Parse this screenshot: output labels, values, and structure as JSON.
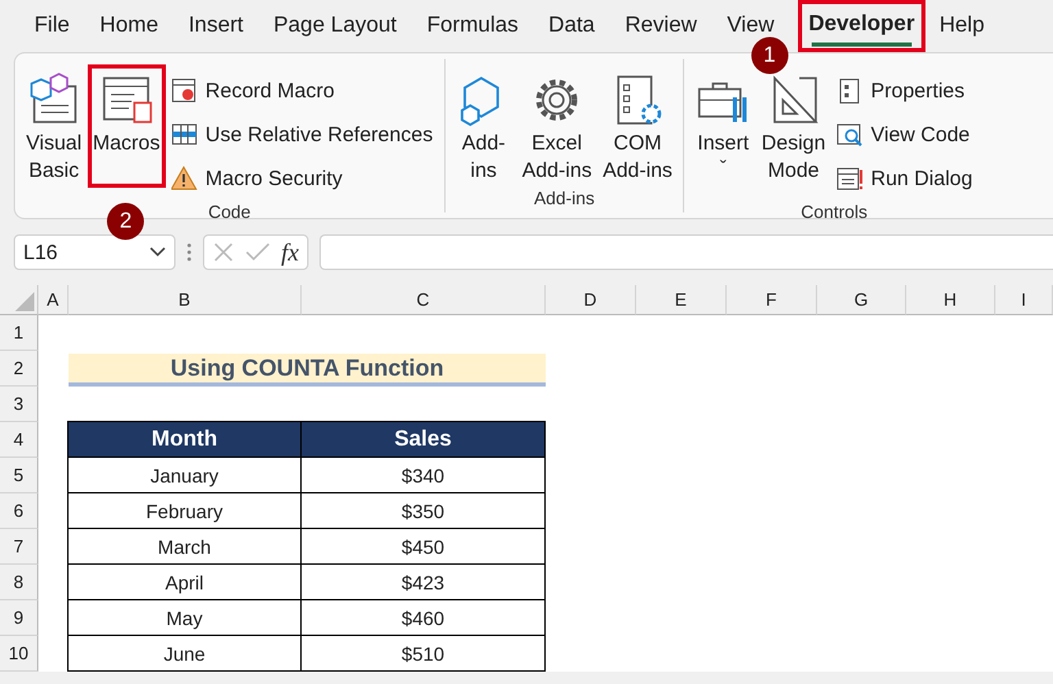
{
  "menu": [
    {
      "label": "File",
      "selected": false
    },
    {
      "label": "Home",
      "selected": false
    },
    {
      "label": "Insert",
      "selected": false
    },
    {
      "label": "Page Layout",
      "selected": false
    },
    {
      "label": "Formulas",
      "selected": false
    },
    {
      "label": "Data",
      "selected": false
    },
    {
      "label": "Review",
      "selected": false
    },
    {
      "label": "View",
      "selected": false
    },
    {
      "label": "Developer",
      "selected": true,
      "callout": "1"
    },
    {
      "label": "Help",
      "selected": false
    }
  ],
  "ribbon": {
    "groups": [
      {
        "label": "Code",
        "large": [
          {
            "label": "Visual\nBasic"
          },
          {
            "label": "Macros",
            "callout": "2"
          }
        ],
        "small": [
          {
            "label": "Record Macro"
          },
          {
            "label": "Use Relative References"
          },
          {
            "label": "Macro Security"
          }
        ]
      },
      {
        "label": "Add-ins",
        "large": [
          {
            "label": "Add-\nins"
          },
          {
            "label": "Excel\nAdd-ins"
          },
          {
            "label": "COM\nAdd-ins"
          }
        ]
      },
      {
        "label": "Controls",
        "large": [
          {
            "label": "Insert",
            "dropdown": "ˇ"
          },
          {
            "label": "Design\nMode"
          }
        ],
        "small": [
          {
            "label": "Properties"
          },
          {
            "label": "View Code"
          },
          {
            "label": "Run Dialog"
          }
        ]
      }
    ]
  },
  "formula_bar": {
    "name_box": "L16",
    "fx": "fx"
  },
  "columns": [
    "A",
    "B",
    "C",
    "D",
    "E",
    "F",
    "G",
    "H",
    "I"
  ],
  "rows": [
    "1",
    "2",
    "3",
    "4",
    "5",
    "6",
    "7",
    "8",
    "9",
    "10"
  ],
  "sheet": {
    "title": "Using COUNTA Function",
    "table": {
      "columns": [
        "Month",
        "Sales"
      ],
      "rows": [
        [
          "January",
          "$340"
        ],
        [
          "February",
          "$350"
        ],
        [
          "March",
          "$450"
        ],
        [
          "April",
          "$423"
        ],
        [
          "May",
          "$460"
        ],
        [
          "June",
          "$510"
        ]
      ]
    }
  }
}
